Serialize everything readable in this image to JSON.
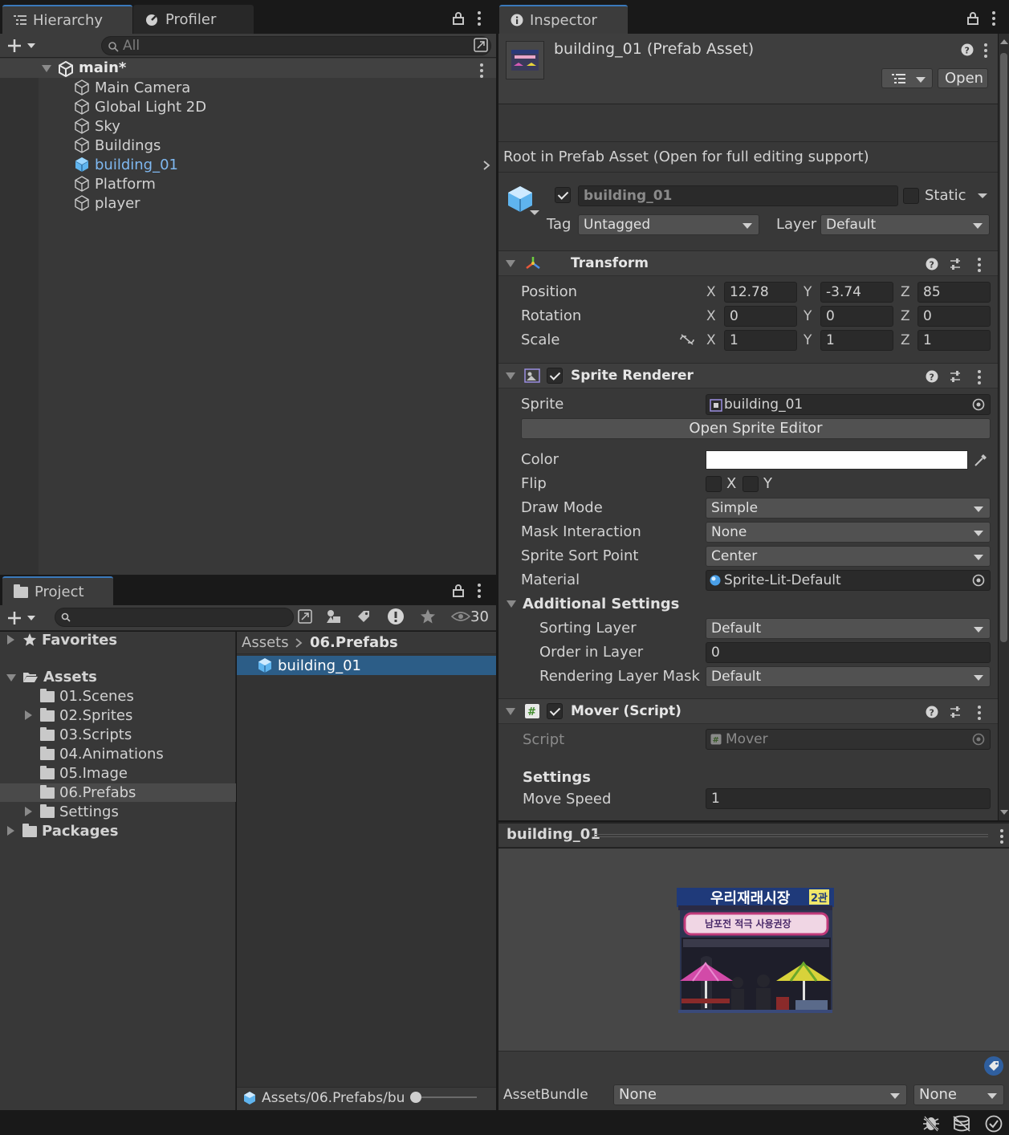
{
  "hierarchy": {
    "tab_hierarchy": "Hierarchy",
    "tab_profiler": "Profiler",
    "search_placeholder": "All",
    "scene_name": "main*",
    "items": [
      "Main Camera",
      "Global Light 2D",
      "Sky",
      "Buildings",
      "building_01",
      "Platform",
      "player"
    ],
    "selected_item": "building_01"
  },
  "project": {
    "tab": "Project",
    "hidden_count": "30",
    "favorites": "Favorites",
    "assets": "Assets",
    "folders": [
      "01.Scenes",
      "02.Sprites",
      "03.Scripts",
      "04.Animations",
      "05.Image",
      "06.Prefabs",
      "Settings"
    ],
    "packages": "Packages",
    "breadcrumb_root": "Assets",
    "breadcrumb_current": "06.Prefabs",
    "file": "building_01",
    "footer_path": "Assets/06.Prefabs/bu"
  },
  "inspector": {
    "tab": "Inspector",
    "asset_title": "building_01 (Prefab Asset)",
    "open_button": "Open",
    "root_note": "Root in Prefab Asset (Open for full editing support)",
    "object_name": "building_01",
    "static_label": "Static",
    "tag_label": "Tag",
    "tag_value": "Untagged",
    "layer_label": "Layer",
    "layer_value": "Default",
    "transform": {
      "title": "Transform",
      "position_label": "Position",
      "rotation_label": "Rotation",
      "scale_label": "Scale",
      "axis_x": "X",
      "axis_y": "Y",
      "axis_z": "Z",
      "position": [
        "12.78",
        "-3.74",
        "85"
      ],
      "rotation": [
        "0",
        "0",
        "0"
      ],
      "scale": [
        "1",
        "1",
        "1"
      ]
    },
    "sprite_renderer": {
      "title": "Sprite Renderer",
      "sprite_label": "Sprite",
      "sprite_value": "building_01",
      "open_editor": "Open Sprite Editor",
      "color_label": "Color",
      "color_value": "#ffffff",
      "flip_label": "Flip",
      "flip_x": "X",
      "flip_y": "Y",
      "draw_mode_label": "Draw Mode",
      "draw_mode": "Simple",
      "mask_label": "Mask Interaction",
      "mask": "None",
      "sort_point_label": "Sprite Sort Point",
      "sort_point": "Center",
      "material_label": "Material",
      "material": "Sprite-Lit-Default",
      "additional": "Additional Settings",
      "sorting_layer_label": "Sorting Layer",
      "sorting_layer": "Default",
      "order_label": "Order in Layer",
      "order": "0",
      "rendering_mask_label": "Rendering Layer Mask",
      "rendering_mask": "Default"
    },
    "mover": {
      "title": "Mover (Script)",
      "script_label": "Script",
      "script_value": "Mover",
      "settings": "Settings",
      "speed_label": "Move Speed",
      "speed": "1"
    },
    "preview": {
      "title": "building_01",
      "sign_text": "우리재래시장",
      "sign_badge": "2관",
      "banner_text": "남포전 적극 사용권장"
    },
    "assetbundle_label": "AssetBundle",
    "assetbundle_name": "None",
    "assetbundle_variant": "None"
  }
}
